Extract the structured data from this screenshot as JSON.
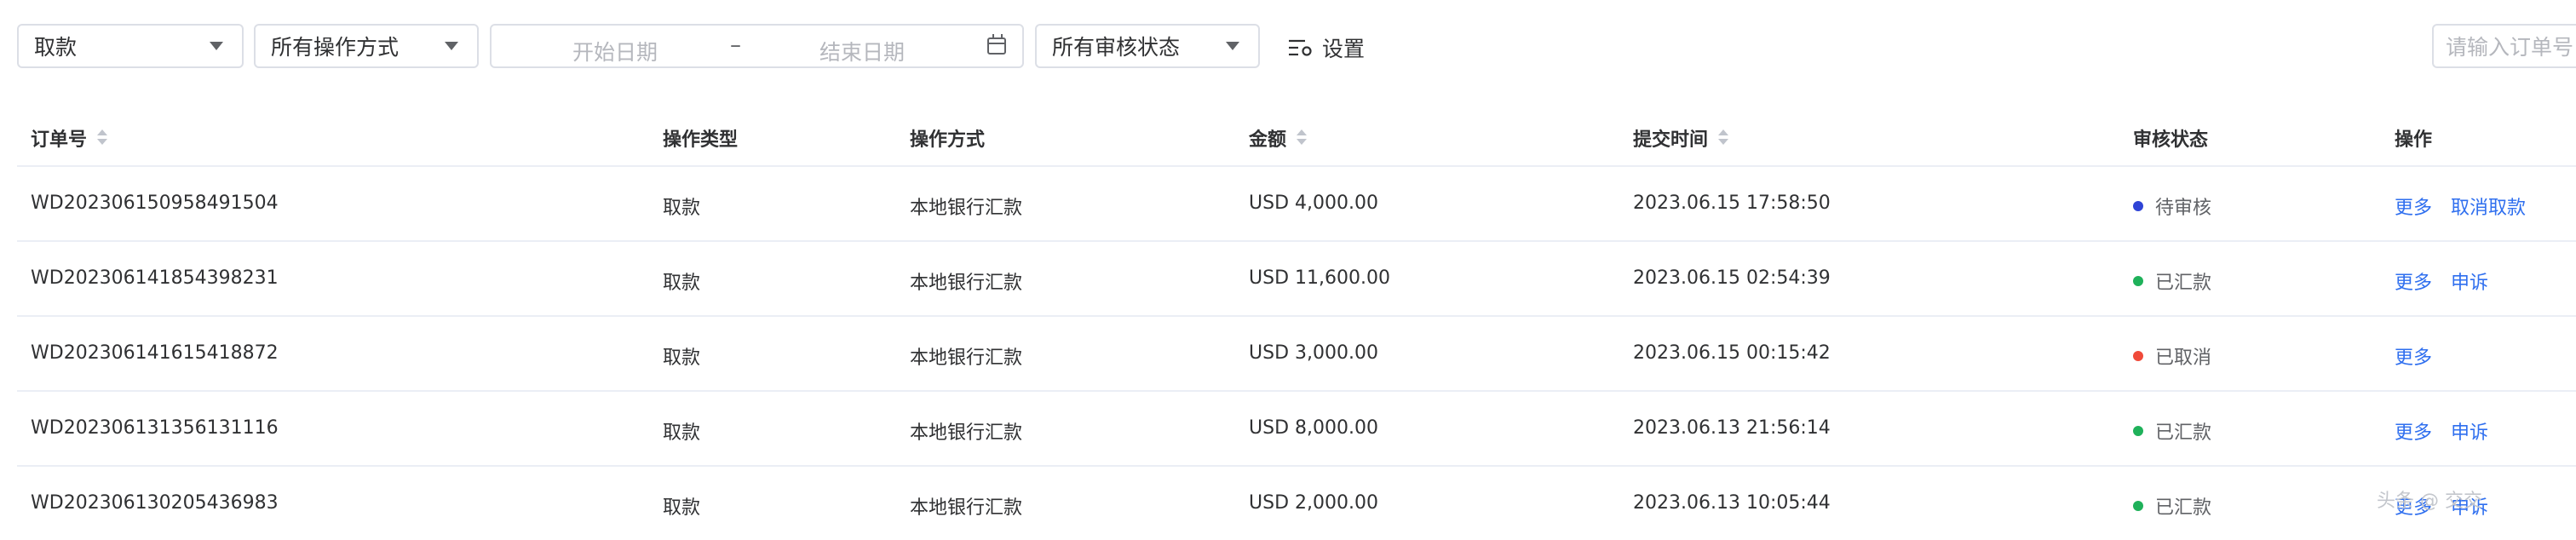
{
  "filters": {
    "type_select": "取款",
    "method_select": "所有操作方式",
    "date_start_placeholder": "开始日期",
    "date_separator": "–",
    "date_end_placeholder": "结束日期",
    "status_select": "所有审核状态",
    "settings_label": "设置",
    "order_placeholder": "请输入订单号"
  },
  "table": {
    "headers": {
      "order_no": "订单号",
      "op_type": "操作类型",
      "op_method": "操作方式",
      "amount": "金额",
      "submit_time": "提交时间",
      "status": "审核状态",
      "actions": "操作"
    },
    "rows": [
      {
        "order_no": "WD202306150958491504",
        "op_type": "取款",
        "op_method": "本地银行汇款",
        "amount": "USD 4,000.00",
        "submit_time": "2023.06.15 17:58:50",
        "status": "待审核",
        "status_color": "#2f44d6",
        "action1": "更多",
        "action2": "取消取款"
      },
      {
        "order_no": "WD202306141854398231",
        "op_type": "取款",
        "op_method": "本地银行汇款",
        "amount": "USD 11,600.00",
        "submit_time": "2023.06.15 02:54:39",
        "status": "已汇款",
        "status_color": "#1fb15a",
        "action1": "更多",
        "action2": "申诉"
      },
      {
        "order_no": "WD202306141615418872",
        "op_type": "取款",
        "op_method": "本地银行汇款",
        "amount": "USD 3,000.00",
        "submit_time": "2023.06.15 00:15:42",
        "status": "已取消",
        "status_color": "#f04a3a",
        "action1": "更多",
        "action2": ""
      },
      {
        "order_no": "WD202306131356131116",
        "op_type": "取款",
        "op_method": "本地银行汇款",
        "amount": "USD 8,000.00",
        "submit_time": "2023.06.13 21:56:14",
        "status": "已汇款",
        "status_color": "#1fb15a",
        "action1": "更多",
        "action2": "申诉"
      },
      {
        "order_no": "WD202306130205436983",
        "op_type": "取款",
        "op_method": "本地银行汇款",
        "amount": "USD 2,000.00",
        "submit_time": "2023.06.13 10:05:44",
        "status": "已汇款",
        "status_color": "#1fb15a",
        "action1": "更多",
        "action2": "申诉"
      }
    ]
  },
  "watermark": "头条 @ 交交"
}
